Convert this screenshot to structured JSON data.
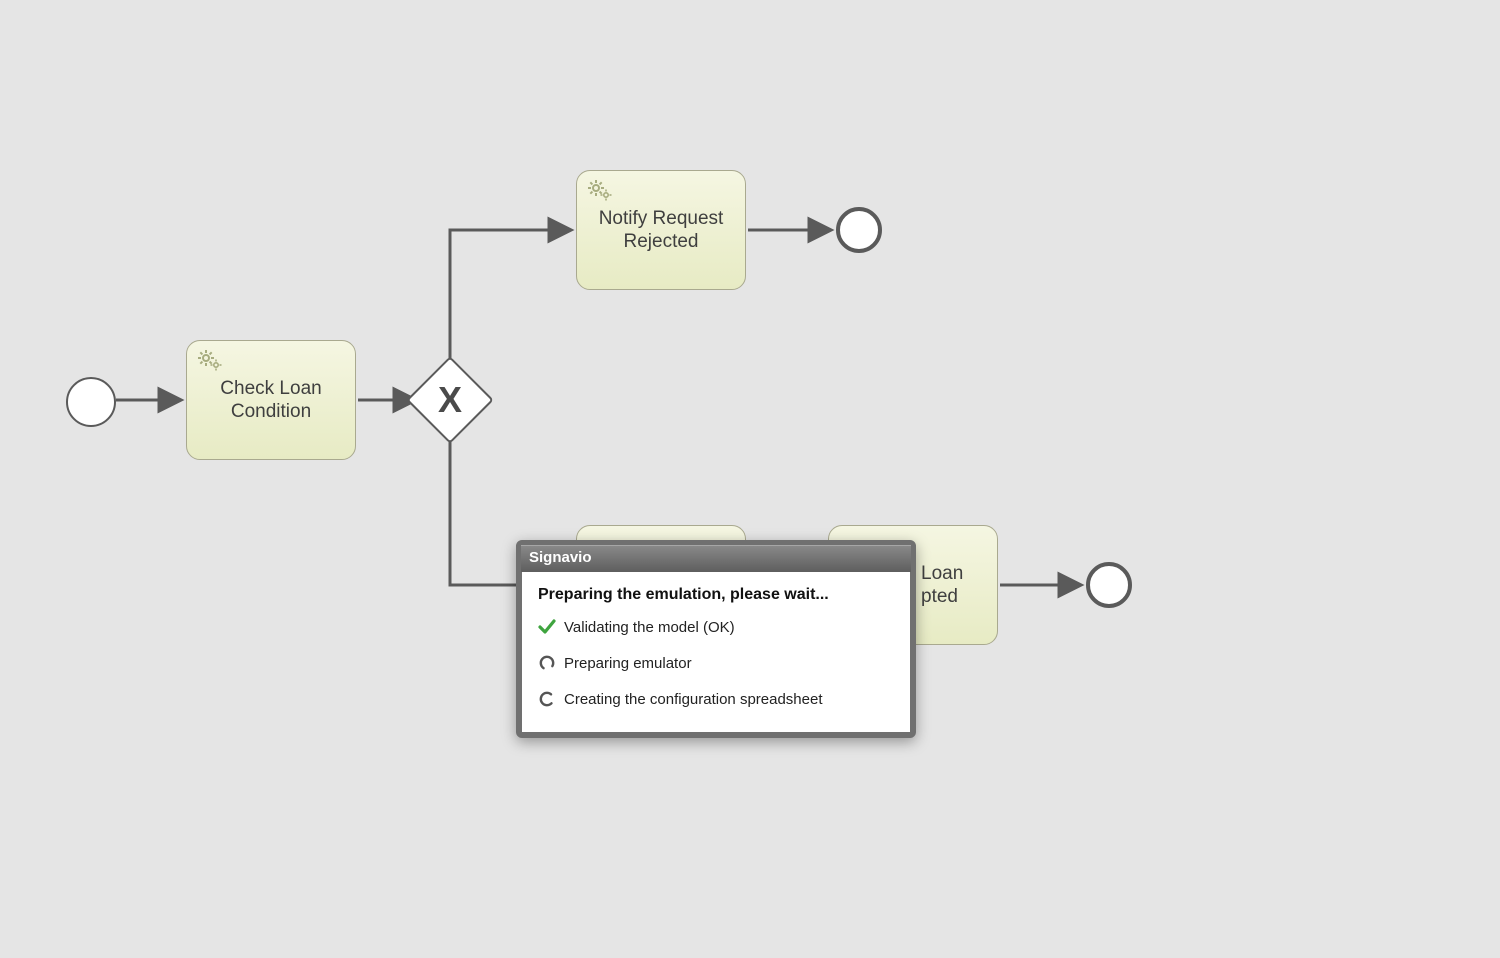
{
  "diagram": {
    "start_event": "",
    "task_check_loan": "Check Loan\nCondition",
    "gateway_label": "X",
    "task_notify_rejected": "Notify Request\nRejected",
    "task_notify_accepted_partial": "Loan\npted",
    "end_event_top": "",
    "end_event_bottom": ""
  },
  "dialog": {
    "title": "Signavio",
    "heading": "Preparing the emulation, please wait...",
    "step_validate": "Validating the model (OK)",
    "step_prepare": "Preparing emulator",
    "step_config": "Creating the configuration spreadsheet"
  }
}
